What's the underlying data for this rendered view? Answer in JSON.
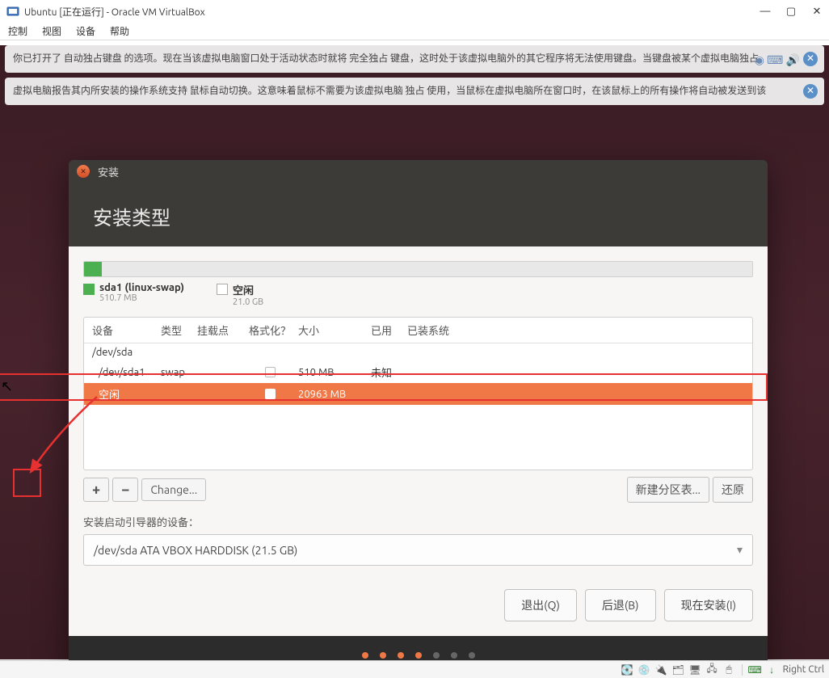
{
  "vbox": {
    "title": "Ubuntu [正在运行] - Oracle VM VirtualBox",
    "menu": {
      "control": "控制",
      "view": "视图",
      "device": "设备",
      "help": "帮助"
    },
    "host_key": "Right Ctrl"
  },
  "notifications": {
    "keyboard": "你已打开了 自动独占键盘 的选项。现在当该虚拟电脑窗口处于活动状态时就将 完全独占 键盘，这时处于该虚拟电脑外的其它程序将无法使用键盘。当键盘被某个虚拟电脑独占",
    "mouse": "虚拟电脑报告其内所安装的操作系统支持 鼠标自动切换。这意味着鼠标不需要为该虚拟电脑 独占 使用，当鼠标在虚拟电脑所在窗口时，在该鼠标上的所有操作将自动被发送到该"
  },
  "installer": {
    "window_title": "安装",
    "header": "安装类型",
    "legend": {
      "swap_name": "sda1 (linux-swap)",
      "swap_size": "510.7 MB",
      "free_name": "空闲",
      "free_size": "21.0 GB"
    },
    "columns": {
      "device": "设备",
      "type": "类型",
      "mount": "挂载点",
      "format": "格式化？",
      "size": "大小",
      "used": "已用",
      "system": "已装系统"
    },
    "rows": [
      {
        "device": "/dev/sda",
        "type": "",
        "mount": "",
        "size": "",
        "used": "",
        "system": ""
      },
      {
        "device": "/dev/sda1",
        "type": "swap",
        "mount": "",
        "size": "510 MB",
        "used": "未知",
        "system": ""
      },
      {
        "device": "空闲",
        "type": "",
        "mount": "",
        "size": "20963 MB",
        "used": "",
        "system": ""
      }
    ],
    "actions": {
      "add": "+",
      "remove": "−",
      "change": "Change...",
      "new_table": "新建分区表...",
      "revert": "还原"
    },
    "bootloader_label": "安装启动引导器的设备：",
    "bootloader_value": "/dev/sda  ATA VBOX HARDDISK (21.5 GB)",
    "nav": {
      "quit": "退出(Q)",
      "back": "后退(B)",
      "install": "现在安装(I)"
    }
  }
}
